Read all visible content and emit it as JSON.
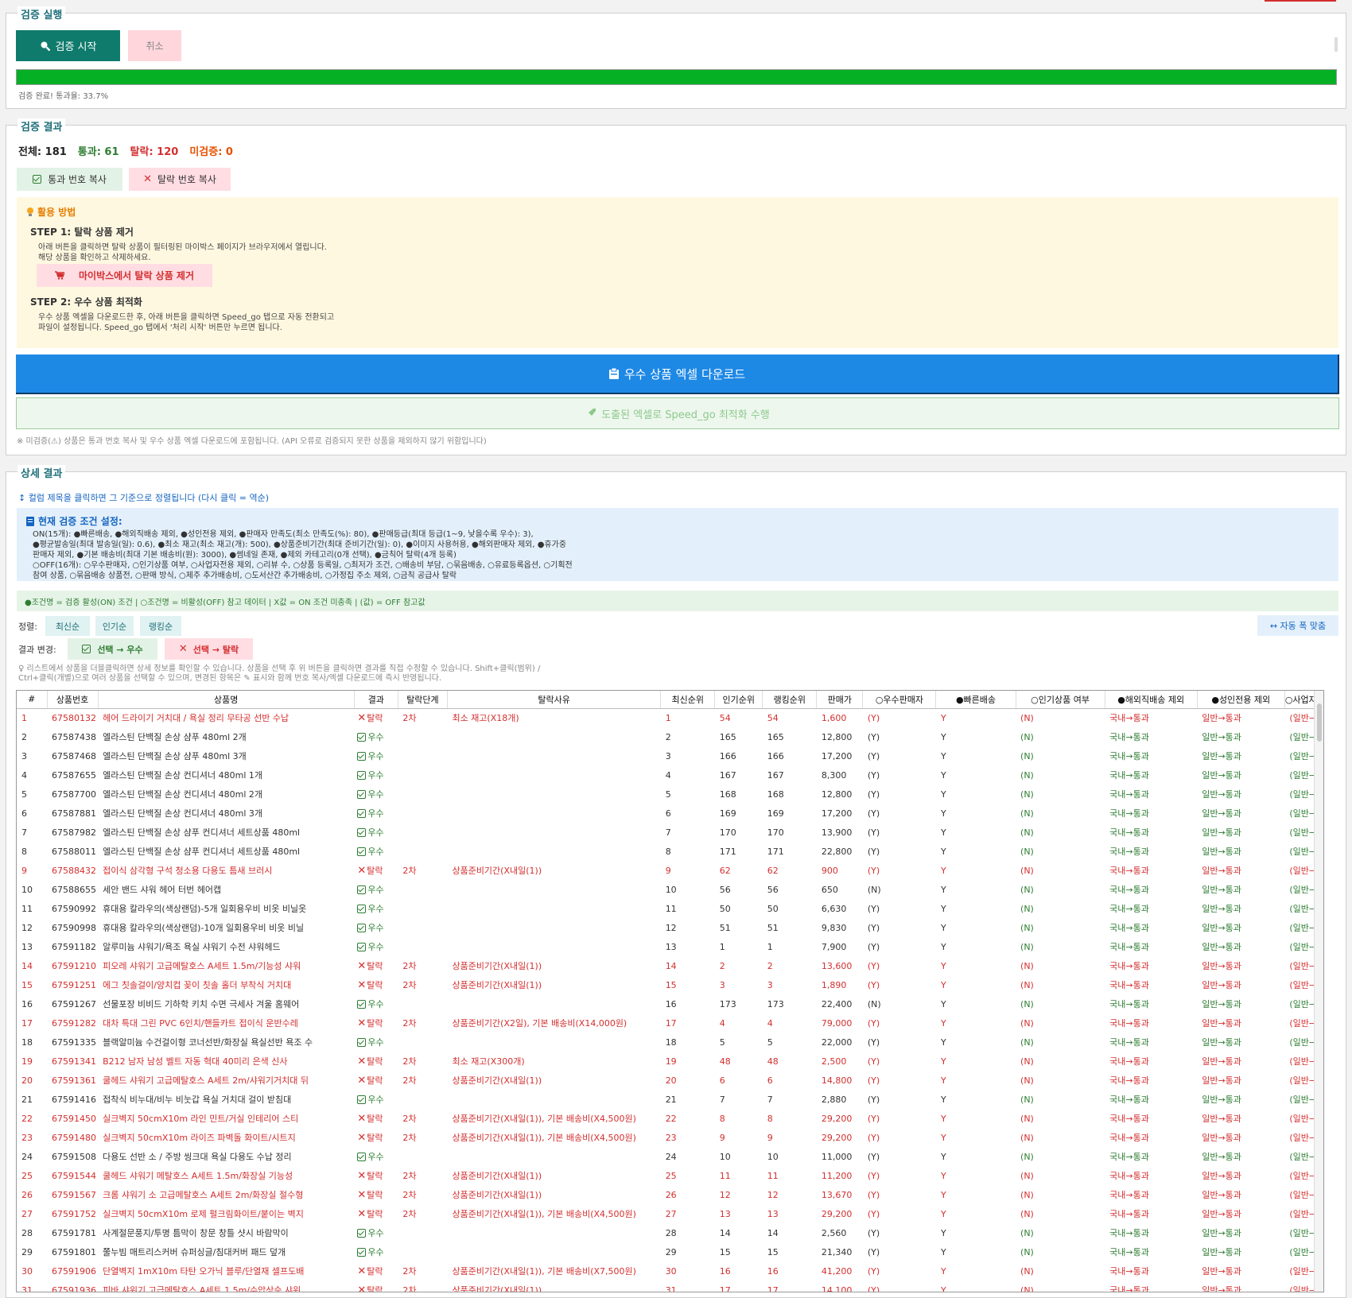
{
  "run": {
    "legend": "검증 실행",
    "start_label": "검증 시작",
    "cancel_label": "취소",
    "progress": 1.0,
    "status": "검증 완료! 통과율: 33.7%"
  },
  "results": {
    "legend": "검증 결과",
    "total_label": "전체: 181",
    "pass_label": "통과: 61",
    "fail_label": "탈락: 120",
    "unverified_label": "미검증: 0",
    "copy_pass_label": "통과 번호 복사",
    "copy_fail_label": "탈락 번호 복사",
    "howto": {
      "title": "활용 방법",
      "step1_title": "STEP 1: 탈락 상품 제거",
      "step1_line1": "아래 버튼을 클릭하면 탈락 상품이 필터링된 마이박스 페이지가 브라우저에서 열립니다.",
      "step1_line2": "해당 상품을 확인하고 삭제하세요.",
      "mybox_button": "마이박스에서 탈락 상품 제거",
      "step2_title": "STEP 2: 우수 상품 최적화",
      "step2_line1": "우수 상품 엑셀을 다운로드한 후, 아래 버튼을 클릭하면 Speed_go 탭으로 자동 전환되고",
      "step2_line2": "파일이 설정됩니다. Speed_go 탭에서 '처리 시작' 버튼만 누르면 됩니다."
    },
    "download_label": "우수 상품 엑셀 다운로드",
    "optimize_label": "도출된 엑셀로 Speed_go 최적화 수행",
    "note": "※ 미검증(⚠) 상품은 통과 번호 복사 및 우수 상품 엑셀 다운로드에 포함됩니다. (API 오류로 검증되지 못한 상품을 제외하지 않기 위함입니다)"
  },
  "detail": {
    "legend": "상세 결과",
    "sort_hint": "↕ 컬럼 제목을 클릭하면 그 기준으로 정렬됩니다 (다시 클릭 = 역순)",
    "cond_title": "현재 검증 조건 설정:",
    "cond_lines": [
      "ON(15개): ●빠른배송, ●해외직배송 제외, ●성인전용 제외, ●판매자 만족도(최소 만족도(%): 80), ●판매등급(최대 등급(1~9, 낮을수록 우수): 3),",
      "●평균발송일(최대 발송일(일): 0.6), ●최소 재고(최소 재고(개): 500), ●상품준비기간(최대 준비기간(일): 0), ●이미지 사용허용, ●해외판매자 제외, ●휴가중",
      "판매자 제외, ●기본 배송비(최대 기본 배송비(원): 3000), ●썸네일 존재, ●제외 카테고리(0개 선택), ●금칙어 탈락(4개 등록)",
      "○OFF(16개): ○우수판매자, ○인기상품 여부, ○사업자전용 제외, ○리뷰 수, ○상품 등록일, ○최저가 조건, ○배송비 부담, ○묶음배송, ○유료등록옵션, ○기획전",
      "참여 상품, ○묶음배송 상품전, ○판매 방식, ○제주 추가배송비, ○도서산간 추가배송비, ○가정집 주소 제외, ○금칙 공급사 탈락"
    ],
    "legend_bar": "●조건명 = 검증 활성(ON) 조건  |  ○조건명 = 비활성(OFF) 참고 데이터  |  X값 = ON 조건 미충족  |  (값) = OFF 참고값",
    "sort_label": "정렬:",
    "sort_buttons": [
      "최신순",
      "인기순",
      "랭킹순"
    ],
    "autofit_label": "↔ 자동 폭 맞춤",
    "change_label": "결과 변경:",
    "to_pass_label": "선택 → 우수",
    "to_fail_label": "선택 → 탈락",
    "tip_line1": "리스트에서 상품을 더블클릭하면 상세 정보를 확인할 수 있습니다. 상품을 선택 후 위 버튼을 클릭하면 결과를 직접 수정할 수 있습니다. Shift+클릭(범위) /",
    "tip_line2": "Ctrl+클릭(개별)으로 여러 상품을 선택할 수 있으며, 변경된 항목은 ✎ 표시와 함께 번호 복사/엑셀 다운로드에 즉시 반영됩니다."
  },
  "table": {
    "columns": [
      "#",
      "상품번호",
      "상품명",
      "결과",
      "탈락단계",
      "탈락사유",
      "최신순위",
      "인기순위",
      "랭킹순위",
      "판매가",
      "○우수판매자",
      "●빠른배송",
      "○인기상품 여부",
      "●해외직배송 제외",
      "●성인전용 제외",
      "○사업자전"
    ],
    "pass_text": "우수",
    "fail_text": "탈락",
    "rows": [
      [
        "1",
        "67580132",
        "헤어 드라이기 거치대 / 욕실 정리 무타공 선반 수납",
        "fail",
        "2차",
        "최소 재고(X18개)",
        "1",
        "54",
        "54",
        "1,600",
        "(Y)",
        "Y",
        "(N)",
        "국내→통과",
        "일반→통과",
        "(일반→통과)"
      ],
      [
        "2",
        "67587438",
        "엘라스틴 단백질 손상 샴푸 480ml 2개",
        "pass",
        "",
        "",
        "2",
        "165",
        "165",
        "12,800",
        "(Y)",
        "Y",
        "(N)",
        "국내→통과",
        "일반→통과",
        "(일반→통과)"
      ],
      [
        "3",
        "67587468",
        "엘라스틴 단백질 손상 샴푸 480ml 3개",
        "pass",
        "",
        "",
        "3",
        "166",
        "166",
        "17,200",
        "(Y)",
        "Y",
        "(N)",
        "국내→통과",
        "일반→통과",
        "(일반→통과)"
      ],
      [
        "4",
        "67587655",
        "엘라스틴 단백질 손상 컨디셔너 480ml 1개",
        "pass",
        "",
        "",
        "4",
        "167",
        "167",
        "8,300",
        "(Y)",
        "Y",
        "(N)",
        "국내→통과",
        "일반→통과",
        "(일반→통과)"
      ],
      [
        "5",
        "67587700",
        "엘라스틴 단백질 손상 컨디셔너 480ml 2개",
        "pass",
        "",
        "",
        "5",
        "168",
        "168",
        "12,800",
        "(Y)",
        "Y",
        "(N)",
        "국내→통과",
        "일반→통과",
        "(일반→통과)"
      ],
      [
        "6",
        "67587881",
        "엘라스틴 단백질 손상 컨디셔너 480ml 3개",
        "pass",
        "",
        "",
        "6",
        "169",
        "169",
        "17,200",
        "(Y)",
        "Y",
        "(N)",
        "국내→통과",
        "일반→통과",
        "(일반→통과)"
      ],
      [
        "7",
        "67587982",
        "엘라스틴 단백질 손상 샴푸 컨디셔너 세트상품 480ml",
        "pass",
        "",
        "",
        "7",
        "170",
        "170",
        "13,900",
        "(Y)",
        "Y",
        "(N)",
        "국내→통과",
        "일반→통과",
        "(일반→통과)"
      ],
      [
        "8",
        "67588011",
        "엘라스틴 단백질 손상 샴푸 컨디셔너 세트상품 480ml",
        "pass",
        "",
        "",
        "8",
        "171",
        "171",
        "22,800",
        "(Y)",
        "Y",
        "(N)",
        "국내→통과",
        "일반→통과",
        "(일반→통과)"
      ],
      [
        "9",
        "67588432",
        "접이식 삼각형 구석 청소용 다용도 틈새 브러시",
        "fail",
        "2차",
        "상품준비기간(X내일(1))",
        "9",
        "62",
        "62",
        "900",
        "(Y)",
        "Y",
        "(N)",
        "국내→통과",
        "일반→통과",
        "(일반→통과)"
      ],
      [
        "10",
        "67588655",
        "세안 밴드 샤워 헤어 터번 헤어캡",
        "pass",
        "",
        "",
        "10",
        "56",
        "56",
        "650",
        "(N)",
        "Y",
        "(N)",
        "국내→통과",
        "일반→통과",
        "(일반→통과)"
      ],
      [
        "11",
        "67590992",
        "휴대용 칼라우의(색상랜덤)-5개 일회용우비 비옷 비닐옷",
        "pass",
        "",
        "",
        "11",
        "50",
        "50",
        "6,630",
        "(Y)",
        "Y",
        "(N)",
        "국내→통과",
        "일반→통과",
        "(일반→통과)"
      ],
      [
        "12",
        "67590998",
        "휴대용 칼라우의(색상랜덤)-10개 일회용우비 비옷 비닐",
        "pass",
        "",
        "",
        "12",
        "51",
        "51",
        "9,830",
        "(Y)",
        "Y",
        "(N)",
        "국내→통과",
        "일반→통과",
        "(일반→통과)"
      ],
      [
        "13",
        "67591182",
        "알루미늄 샤워기/욕조 욕실 샤워기 수전 샤워헤드",
        "pass",
        "",
        "",
        "13",
        "1",
        "1",
        "7,900",
        "(Y)",
        "Y",
        "(N)",
        "국내→통과",
        "일반→통과",
        "(일반→통과)"
      ],
      [
        "14",
        "67591210",
        "피오레 샤워기 고급메탈호스 A세트 1.5m/기능성 샤워",
        "fail",
        "2차",
        "상품준비기간(X내일(1))",
        "14",
        "2",
        "2",
        "13,600",
        "(Y)",
        "Y",
        "(N)",
        "국내→통과",
        "일반→통과",
        "(일반→통과)"
      ],
      [
        "15",
        "67591251",
        "에그 칫솔걸이/양치컵 꽂이 칫솔 홀더 부착식 거치대",
        "fail",
        "2차",
        "상품준비기간(X내일(1))",
        "15",
        "3",
        "3",
        "1,890",
        "(Y)",
        "Y",
        "(N)",
        "국내→통과",
        "일반→통과",
        "(일반→통과)"
      ],
      [
        "16",
        "67591267",
        "선물포장 비비드 기하학 키치 수면 극세사 겨울 홈웨어",
        "pass",
        "",
        "",
        "16",
        "173",
        "173",
        "22,400",
        "(N)",
        "Y",
        "(N)",
        "국내→통과",
        "일반→통과",
        "(일반→통과)"
      ],
      [
        "17",
        "67591282",
        "대차 특대 그린 PVC 6인치/핸들카트 접이식 운반수레",
        "fail",
        "2차",
        "상품준비기간(X2일), 기본 배송비(X14,000원)",
        "17",
        "4",
        "4",
        "79,000",
        "(Y)",
        "Y",
        "(N)",
        "국내→통과",
        "일반→통과",
        "(일반→통과)"
      ],
      [
        "18",
        "67591335",
        "블랙알미늄 수건걸이형 코너선반/화장실 욕실선반 욕조 수",
        "pass",
        "",
        "",
        "18",
        "5",
        "5",
        "22,000",
        "(Y)",
        "Y",
        "(N)",
        "국내→통과",
        "일반→통과",
        "(일반→통과)"
      ],
      [
        "19",
        "67591341",
        "B212 남자 남성 벨트 자동 혁대 40미리 은색 신사",
        "fail",
        "2차",
        "최소 재고(X300개)",
        "19",
        "48",
        "48",
        "2,500",
        "(Y)",
        "Y",
        "(N)",
        "국내→통과",
        "일반→통과",
        "(일반→통과)"
      ],
      [
        "20",
        "67591361",
        "쿨헤드 샤워기 고급메탈호스 A세트 2m/샤워기거치대 뒤",
        "fail",
        "2차",
        "상품준비기간(X내일(1))",
        "20",
        "6",
        "6",
        "14,800",
        "(Y)",
        "Y",
        "(N)",
        "국내→통과",
        "일반→통과",
        "(일반→통과)"
      ],
      [
        "21",
        "67591416",
        "접착식 비누대/비누 비눗갑 욕실 거치대 걸이 받침대",
        "pass",
        "",
        "",
        "21",
        "7",
        "7",
        "2,880",
        "(Y)",
        "Y",
        "(N)",
        "국내→통과",
        "일반→통과",
        "(일반→통과)"
      ],
      [
        "22",
        "67591450",
        "실크벽지 50cmX10m 라인 민트/거실 인테리어 스티",
        "fail",
        "2차",
        "상품준비기간(X내일(1)), 기본 배송비(X4,500원)",
        "22",
        "8",
        "8",
        "29,200",
        "(Y)",
        "Y",
        "(N)",
        "국내→통과",
        "일반→통과",
        "(일반→통과)"
      ],
      [
        "23",
        "67591480",
        "실크벽지 50cmX10m 라이즈 파벽돌 화이트/시트지",
        "fail",
        "2차",
        "상품준비기간(X내일(1)), 기본 배송비(X4,500원)",
        "23",
        "9",
        "9",
        "29,200",
        "(Y)",
        "Y",
        "(N)",
        "국내→통과",
        "일반→통과",
        "(일반→통과)"
      ],
      [
        "24",
        "67591508",
        "다용도 선반 소 / 주방 씽크대 욕실 다용도 수납 정리",
        "pass",
        "",
        "",
        "24",
        "10",
        "10",
        "11,000",
        "(Y)",
        "Y",
        "(N)",
        "국내→통과",
        "일반→통과",
        "(일반→통과)"
      ],
      [
        "25",
        "67591544",
        "쿨헤드 샤워기 메탈호스 A세트 1.5m/화장실 기능성",
        "fail",
        "2차",
        "상품준비기간(X내일(1))",
        "25",
        "11",
        "11",
        "11,200",
        "(Y)",
        "Y",
        "(N)",
        "국내→통과",
        "일반→통과",
        "(일반→통과)"
      ],
      [
        "26",
        "67591567",
        "크롬 샤워기 소 고급메탈호스 A세트 2m/화장실 절수형",
        "fail",
        "2차",
        "상품준비기간(X내일(1))",
        "26",
        "12",
        "12",
        "13,670",
        "(Y)",
        "Y",
        "(N)",
        "국내→통과",
        "일반→통과",
        "(일반→통과)"
      ],
      [
        "27",
        "67591752",
        "실크벽지 50cmX10m 로제 펄크림화이트/붙이는 벽지",
        "fail",
        "2차",
        "상품준비기간(X내일(1)), 기본 배송비(X4,500원)",
        "27",
        "13",
        "13",
        "29,200",
        "(Y)",
        "Y",
        "(N)",
        "국내→통과",
        "일반→통과",
        "(일반→통과)"
      ],
      [
        "28",
        "67591781",
        "사계절문풍지/투명 틈막이 창문 창틀 샷시 바람막이",
        "pass",
        "",
        "",
        "28",
        "14",
        "14",
        "2,560",
        "(Y)",
        "Y",
        "(N)",
        "국내→통과",
        "일반→통과",
        "(일반→통과)"
      ],
      [
        "29",
        "67591801",
        "쭐누빔 매트리스커버 슈퍼싱글/침대커버 패드 덮개",
        "pass",
        "",
        "",
        "29",
        "15",
        "15",
        "21,340",
        "(Y)",
        "Y",
        "(N)",
        "국내→통과",
        "일반→통과",
        "(일반→통과)"
      ],
      [
        "30",
        "67591906",
        "단열벽지 1mX10m 타탄 오가닉 블루/단열재 셀프도배",
        "fail",
        "2차",
        "상품준비기간(X내일(1)), 기본 배송비(X7,500원)",
        "30",
        "16",
        "16",
        "41,200",
        "(Y)",
        "Y",
        "(N)",
        "국내→통과",
        "일반→통과",
        "(일반→통과)"
      ],
      [
        "31",
        "67591936",
        "피바 샤워기 고급메탈호스 A세트 1.5m/수압상승 샤워",
        "fail",
        "2차",
        "상품준비기간(X내일(1))",
        "31",
        "17",
        "17",
        "14,100",
        "(Y)",
        "Y",
        "(N)",
        "국내→통과",
        "일반→통과",
        "(일반→통과)"
      ]
    ]
  }
}
